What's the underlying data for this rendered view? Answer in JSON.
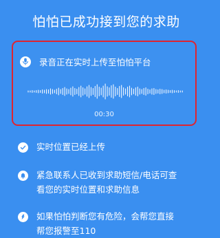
{
  "header": {
    "title": "怕怕已成功接到您的求助"
  },
  "recording": {
    "label": "录音正在实时上传至怕怕平台",
    "elapsed": "00:30",
    "mic_icon": "microphone-icon",
    "highlight_color": "#e0242f"
  },
  "status_items": [
    {
      "icon": "checkmark-icon",
      "lines": [
        "实时位置已经上传"
      ]
    },
    {
      "icon": "bell-icon",
      "lines": [
        "紧急联系人已收到求助短信/电话可查",
        "看您的实时位置和求助信息"
      ]
    },
    {
      "icon": "alert-icon",
      "lines": [
        "如果怕怕判断您有危险，会帮您直接",
        "帮您报警至110"
      ]
    }
  ],
  "colors": {
    "background": "#3a8ff0",
    "text": "#ffffff"
  }
}
